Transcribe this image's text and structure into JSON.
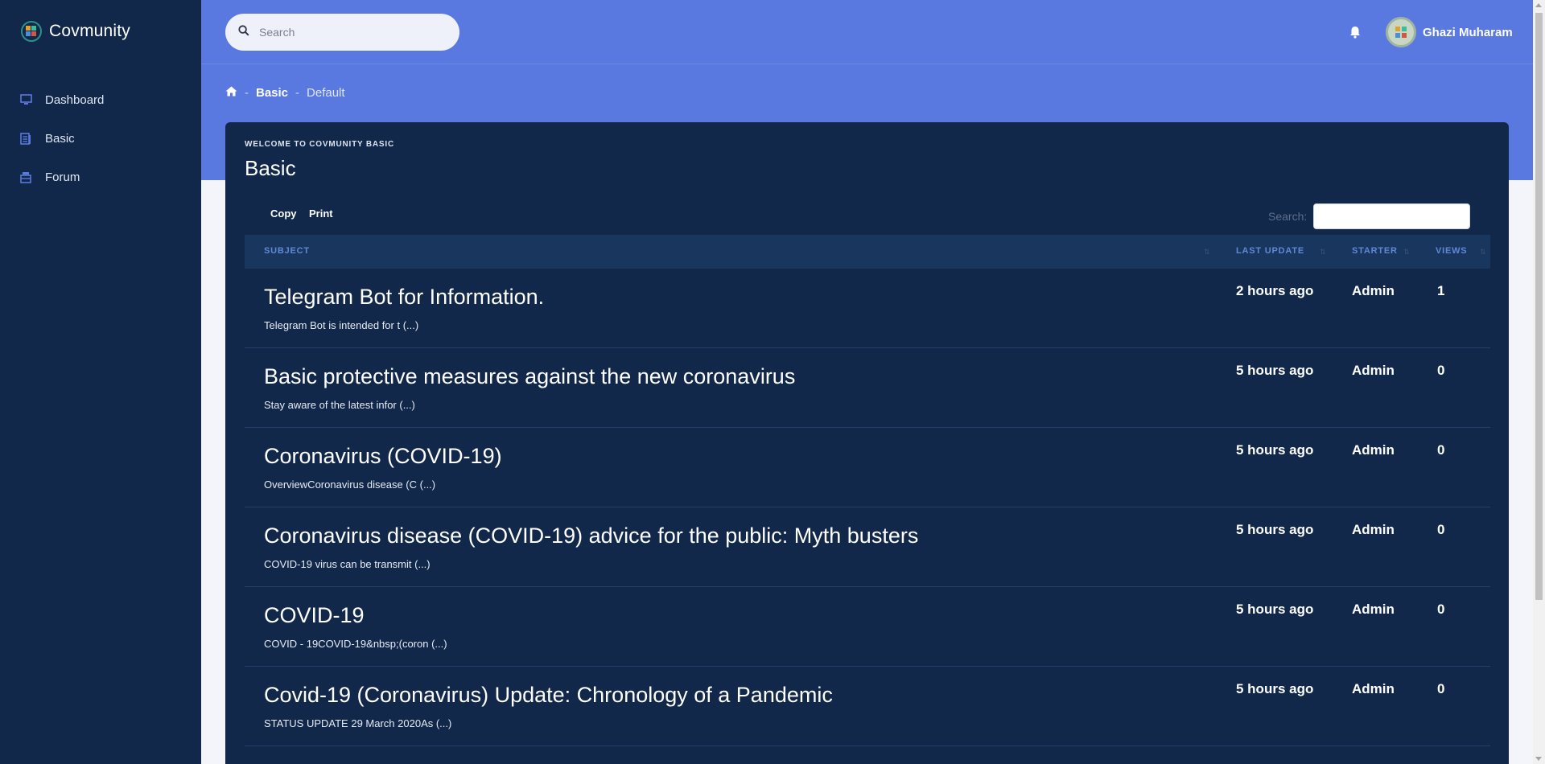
{
  "app": {
    "name": "Covmunity"
  },
  "sidebar": {
    "items": [
      {
        "label": "Dashboard",
        "icon": "monitor-icon"
      },
      {
        "label": "Basic",
        "icon": "document-icon"
      },
      {
        "label": "Forum",
        "icon": "inbox-icon"
      }
    ]
  },
  "header": {
    "search_placeholder": "Search",
    "user_name": "Ghazi Muharam"
  },
  "breadcrumb": {
    "items": [
      "Basic",
      "Default"
    ]
  },
  "card": {
    "subtitle": "WELCOME TO COVMUNITY BASIC",
    "title": "Basic",
    "buttons": {
      "copy": "Copy",
      "print": "Print"
    },
    "search_label": "Search:"
  },
  "table": {
    "columns": {
      "subject": "SUBJECT",
      "last_update": "LAST UPDATE",
      "starter": "STARTER",
      "views": "VIEWS"
    },
    "rows": [
      {
        "title": "Telegram Bot for Information.",
        "snippet": "Telegram Bot is intended for t (...)",
        "last_update": "2 hours ago",
        "starter": "Admin",
        "views": "1"
      },
      {
        "title": "Basic protective measures against the new coronavirus",
        "snippet": "Stay aware of the latest infor (...)",
        "last_update": "5 hours ago",
        "starter": "Admin",
        "views": "0"
      },
      {
        "title": "Coronavirus (COVID-19)",
        "snippet": "OverviewCoronavirus disease (C (...)",
        "last_update": "5 hours ago",
        "starter": "Admin",
        "views": "0"
      },
      {
        "title": "Coronavirus disease (COVID-19) advice for the public: Myth busters",
        "snippet": "COVID-19 virus can be transmit (...)",
        "last_update": "5 hours ago",
        "starter": "Admin",
        "views": "0"
      },
      {
        "title": "COVID-19",
        "snippet": "COVID - 19COVID-19&nbsp;(coron (...)",
        "last_update": "5 hours ago",
        "starter": "Admin",
        "views": "0"
      },
      {
        "title": "Covid-19 (Coronavirus) Update: Chronology of a Pandemic",
        "snippet": "STATUS UPDATE 29 March 2020As (...)",
        "last_update": "5 hours ago",
        "starter": "Admin",
        "views": "0"
      }
    ]
  },
  "colors": {
    "sidebar_bg": "#12284a",
    "header_bg": "#5a79e0",
    "card_bg": "#12284a",
    "accent": "#5f89d6"
  }
}
